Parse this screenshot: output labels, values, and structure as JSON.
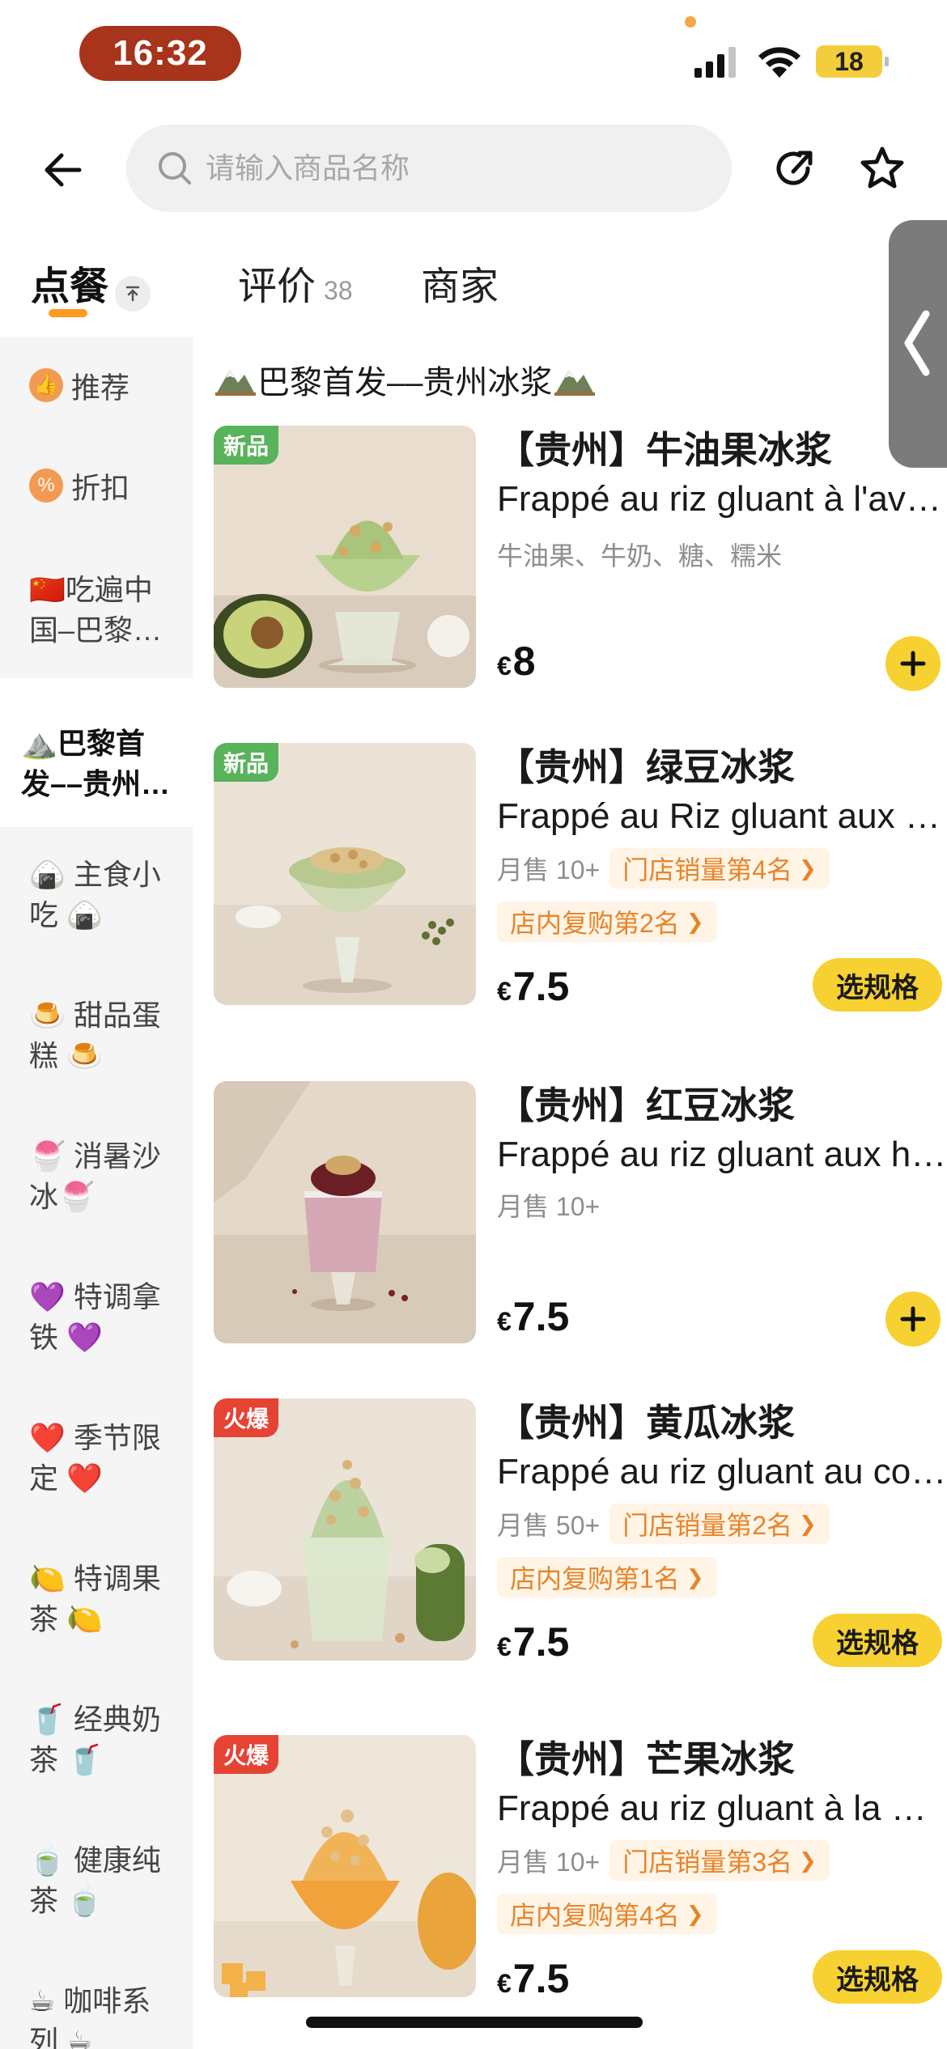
{
  "status_bar": {
    "time": "16:32",
    "battery": "18"
  },
  "header": {
    "search_placeholder": "请输入商品名称"
  },
  "tabs": [
    {
      "label": "点餐"
    },
    {
      "label": "评价",
      "count": "38"
    },
    {
      "label": "商家"
    }
  ],
  "sidebar": {
    "items": [
      {
        "label": "推荐",
        "icon": "thumbs-up-icon"
      },
      {
        "label": "折扣",
        "icon": "discount-tag-icon"
      },
      {
        "label": "🇨🇳吃遍中国–巴黎…"
      },
      {
        "label": "⛰️巴黎首发––贵州…",
        "active": true
      },
      {
        "label": "🍙 主食小吃 🍙"
      },
      {
        "label": "🍮 甜品蛋糕 🍮"
      },
      {
        "label": "🍧 消暑沙冰🍧"
      },
      {
        "label": "💜 特调拿铁 💜"
      },
      {
        "label": "❤️ 季节限定 ❤️"
      },
      {
        "label": "🍋 特调果茶 🍋"
      },
      {
        "label": "🥤 经典奶茶 🥤"
      },
      {
        "label": "🍵 健康纯茶 🍵"
      },
      {
        "label": "☕ 咖啡系列 ☕"
      }
    ]
  },
  "section": {
    "title": "巴黎首发––贵州冰浆"
  },
  "products": [
    {
      "badge": "新品",
      "badge_type": "new",
      "name": "【贵州】牛油果冰浆",
      "subtitle": "Frappé au riz gluant à l'avocat",
      "description": "牛油果、牛奶、糖、糯米",
      "currency": "€",
      "price": "8",
      "action": "add",
      "image": "avocado-frappe-image"
    },
    {
      "badge": "新品",
      "badge_type": "new",
      "name": "【贵州】绿豆冰浆",
      "subtitle": "Frappé au Riz gluant aux haricots mungo",
      "monthly_sales": "月售 10+",
      "tag1": "门店销量第4名",
      "tag2": "店内复购第2名",
      "currency": "€",
      "price": "7.5",
      "action": "spec",
      "action_label": "选规格",
      "image": "mung-bean-frappe-image"
    },
    {
      "name": "【贵州】红豆冰浆",
      "subtitle": "Frappé au riz gluant aux haricots rouges",
      "monthly_sales": "月售 10+",
      "currency": "€",
      "price": "7.5",
      "action": "add",
      "image": "red-bean-frappe-image"
    },
    {
      "badge": "火爆",
      "badge_type": "hot",
      "name": "【贵州】黄瓜冰浆",
      "subtitle": "Frappé au riz gluant au concombre",
      "monthly_sales": "月售 50+",
      "tag1": "门店销量第2名",
      "tag2": "店内复购第1名",
      "currency": "€",
      "price": "7.5",
      "action": "spec",
      "action_label": "选规格",
      "image": "cucumber-frappe-image"
    },
    {
      "badge": "火爆",
      "badge_type": "hot",
      "name": "【贵州】芒果冰浆",
      "subtitle": "Frappé au riz gluant à la mangue",
      "monthly_sales": "月售 10+",
      "tag1": "门店销量第3名",
      "tag2": "店内复购第4名",
      "currency": "€",
      "price": "7.5",
      "action": "spec",
      "action_label": "选规格",
      "image": "mango-frappe-image"
    }
  ],
  "colors": {
    "accent": "#f7d131",
    "tab_underline": "#ff9a1e",
    "tag_text": "#e7842b",
    "new_badge": "#58b35b",
    "hot_badge": "#e54434"
  }
}
